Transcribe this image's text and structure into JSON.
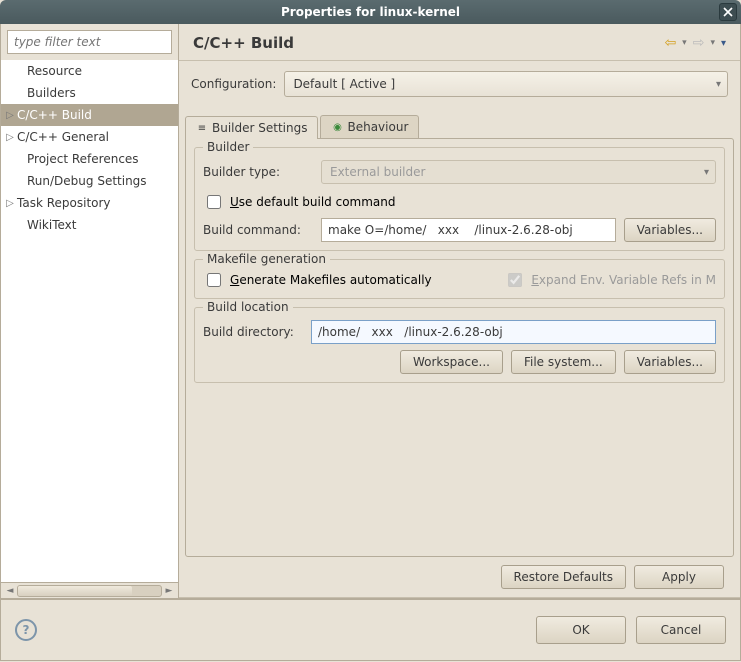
{
  "window": {
    "title": "Properties for linux-kernel"
  },
  "filter": {
    "placeholder": "type filter text"
  },
  "tree": {
    "items": [
      {
        "label": "Resource",
        "expandable": false
      },
      {
        "label": "Builders",
        "expandable": false
      },
      {
        "label": "C/C++ Build",
        "expandable": true,
        "selected": true
      },
      {
        "label": "C/C++ General",
        "expandable": true
      },
      {
        "label": "Project References",
        "expandable": false
      },
      {
        "label": "Run/Debug Settings",
        "expandable": false
      },
      {
        "label": "Task Repository",
        "expandable": true
      },
      {
        "label": "WikiText",
        "expandable": false
      }
    ]
  },
  "page": {
    "title": "C/C++ Build"
  },
  "config": {
    "label": "Configuration:",
    "value": "Default  [ Active ]"
  },
  "tabs": {
    "builder_settings": "Builder Settings",
    "behaviour": "Behaviour"
  },
  "builder_group": {
    "title": "Builder",
    "type_label": "Builder type:",
    "type_value": "External builder",
    "use_default_label": "Use default build command",
    "build_cmd_label": "Build command:",
    "build_cmd_value": "make O=/home/   xxx    /linux-2.6.28-obj",
    "variables_btn": "Variables..."
  },
  "makefile_group": {
    "title": "Makefile generation",
    "generate_label": "Generate Makefiles automatically",
    "expand_label": "Expand Env. Variable Refs in M"
  },
  "location_group": {
    "title": "Build location",
    "dir_label": "Build directory:",
    "dir_value": "/home/   xxx   /linux-2.6.28-obj",
    "workspace_btn": "Workspace...",
    "filesystem_btn": "File system...",
    "variables_btn": "Variables..."
  },
  "actions": {
    "restore": "Restore Defaults",
    "apply": "Apply",
    "ok": "OK",
    "cancel": "Cancel"
  }
}
